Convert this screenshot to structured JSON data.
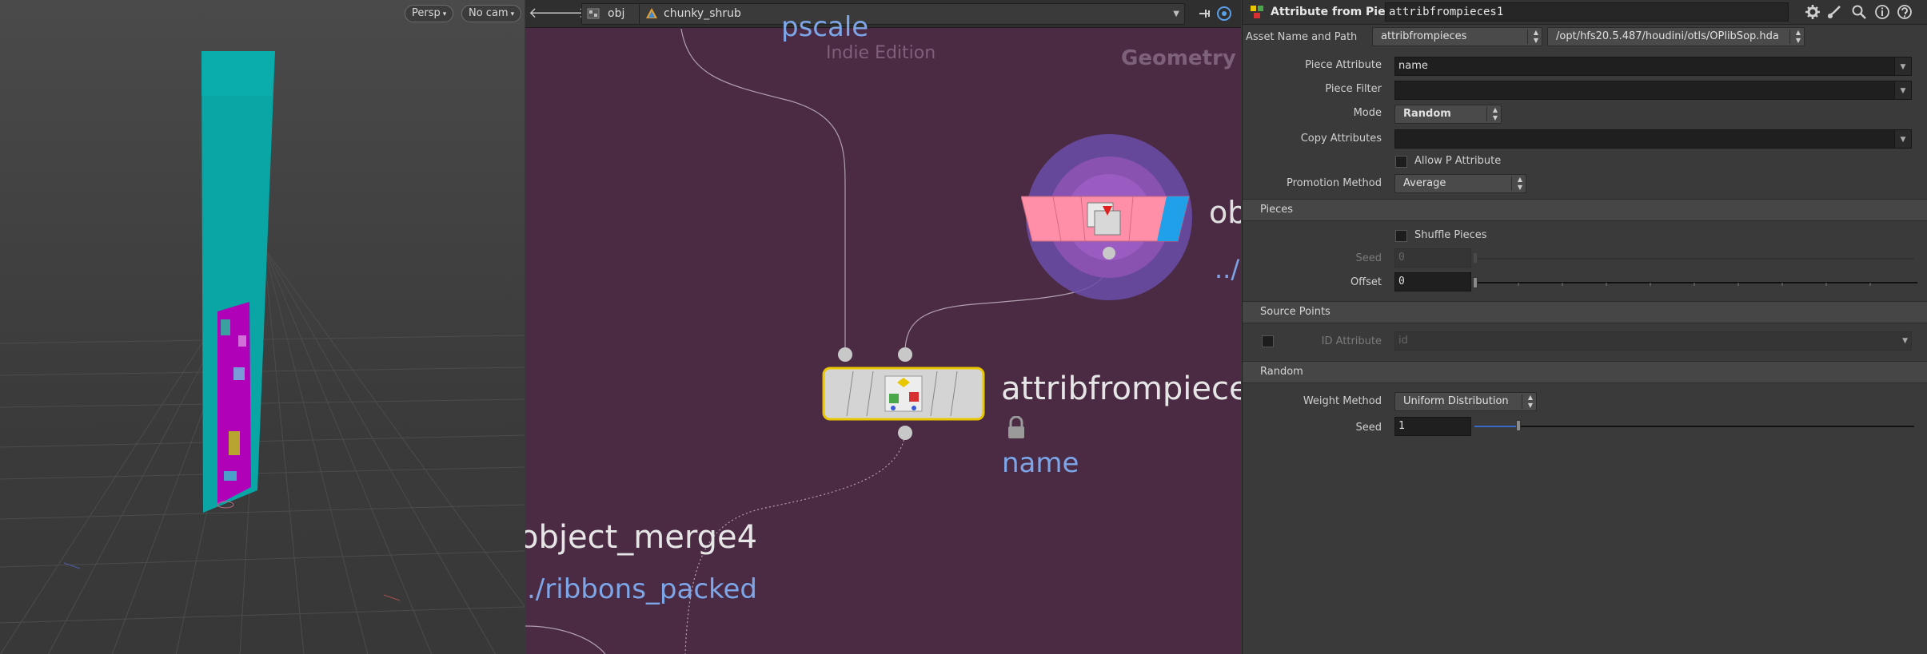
{
  "viewport": {
    "persp_label": "Persp",
    "cam_label": "No cam"
  },
  "network": {
    "path": {
      "root": "obj",
      "node": "chunky_shrub"
    },
    "watermark": {
      "edition": "Indie Edition",
      "context": "Geometry"
    },
    "nodes": {
      "top_partial_label": "pscale",
      "attribfrompieces": {
        "name": "attribfrompieces",
        "comment": "name"
      },
      "object_merge_right": {
        "name": "ob",
        "path": "../"
      },
      "object_merge4": {
        "name": "object_merge4",
        "path": "./ribbons_packed"
      }
    }
  },
  "params": {
    "title": "Attribute from Pieces",
    "node_name": "attribfrompieces1",
    "asset_label": "Asset Name and Path",
    "asset_name": "attribfrompieces",
    "asset_path": "/opt/hfs20.5.487/houdini/otls/OPlibSop.hda",
    "piece_attribute": {
      "label": "Piece Attribute",
      "value": "name"
    },
    "piece_filter": {
      "label": "Piece Filter",
      "value": ""
    },
    "mode": {
      "label": "Mode",
      "value": "Random"
    },
    "copy_attributes": {
      "label": "Copy Attributes",
      "value": ""
    },
    "allow_p": {
      "label": "Allow P Attribute"
    },
    "promotion": {
      "label": "Promotion Method",
      "value": "Average"
    },
    "sections": {
      "pieces": "Pieces",
      "source_points": "Source Points",
      "random": "Random"
    },
    "shuffle": {
      "label": "Shuffle Pieces"
    },
    "seed_pieces": {
      "label": "Seed",
      "value": "0"
    },
    "offset": {
      "label": "Offset",
      "value": "0"
    },
    "id_attribute": {
      "label": "ID Attribute",
      "value": "id"
    },
    "weight_method": {
      "label": "Weight Method",
      "value": "Uniform Distribution"
    },
    "seed_random": {
      "label": "Seed",
      "value": "1",
      "slider_fraction": 0.1
    }
  },
  "colors": {
    "network_bg": "#4b2a44",
    "node_selected_outline": "#e8c600",
    "merge_node_pink": "#ff8fa8",
    "merge_node_blue": "#1fa0e8",
    "geometry_cyan": "#0aa5a5",
    "geometry_magenta": "#b000b8",
    "path_text_blue": "#7da6e8"
  }
}
